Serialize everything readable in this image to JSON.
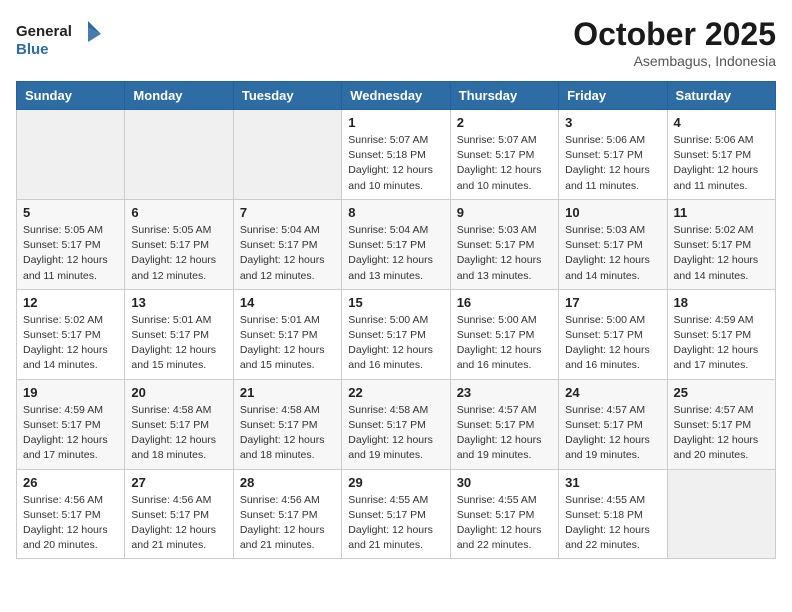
{
  "header": {
    "logo_line1": "General",
    "logo_line2": "Blue",
    "month": "October 2025",
    "location": "Asembagus, Indonesia"
  },
  "weekdays": [
    "Sunday",
    "Monday",
    "Tuesday",
    "Wednesday",
    "Thursday",
    "Friday",
    "Saturday"
  ],
  "weeks": [
    [
      {
        "day": "",
        "info": ""
      },
      {
        "day": "",
        "info": ""
      },
      {
        "day": "",
        "info": ""
      },
      {
        "day": "1",
        "info": "Sunrise: 5:07 AM\nSunset: 5:18 PM\nDaylight: 12 hours\nand 10 minutes."
      },
      {
        "day": "2",
        "info": "Sunrise: 5:07 AM\nSunset: 5:17 PM\nDaylight: 12 hours\nand 10 minutes."
      },
      {
        "day": "3",
        "info": "Sunrise: 5:06 AM\nSunset: 5:17 PM\nDaylight: 12 hours\nand 11 minutes."
      },
      {
        "day": "4",
        "info": "Sunrise: 5:06 AM\nSunset: 5:17 PM\nDaylight: 12 hours\nand 11 minutes."
      }
    ],
    [
      {
        "day": "5",
        "info": "Sunrise: 5:05 AM\nSunset: 5:17 PM\nDaylight: 12 hours\nand 11 minutes."
      },
      {
        "day": "6",
        "info": "Sunrise: 5:05 AM\nSunset: 5:17 PM\nDaylight: 12 hours\nand 12 minutes."
      },
      {
        "day": "7",
        "info": "Sunrise: 5:04 AM\nSunset: 5:17 PM\nDaylight: 12 hours\nand 12 minutes."
      },
      {
        "day": "8",
        "info": "Sunrise: 5:04 AM\nSunset: 5:17 PM\nDaylight: 12 hours\nand 13 minutes."
      },
      {
        "day": "9",
        "info": "Sunrise: 5:03 AM\nSunset: 5:17 PM\nDaylight: 12 hours\nand 13 minutes."
      },
      {
        "day": "10",
        "info": "Sunrise: 5:03 AM\nSunset: 5:17 PM\nDaylight: 12 hours\nand 14 minutes."
      },
      {
        "day": "11",
        "info": "Sunrise: 5:02 AM\nSunset: 5:17 PM\nDaylight: 12 hours\nand 14 minutes."
      }
    ],
    [
      {
        "day": "12",
        "info": "Sunrise: 5:02 AM\nSunset: 5:17 PM\nDaylight: 12 hours\nand 14 minutes."
      },
      {
        "day": "13",
        "info": "Sunrise: 5:01 AM\nSunset: 5:17 PM\nDaylight: 12 hours\nand 15 minutes."
      },
      {
        "day": "14",
        "info": "Sunrise: 5:01 AM\nSunset: 5:17 PM\nDaylight: 12 hours\nand 15 minutes."
      },
      {
        "day": "15",
        "info": "Sunrise: 5:00 AM\nSunset: 5:17 PM\nDaylight: 12 hours\nand 16 minutes."
      },
      {
        "day": "16",
        "info": "Sunrise: 5:00 AM\nSunset: 5:17 PM\nDaylight: 12 hours\nand 16 minutes."
      },
      {
        "day": "17",
        "info": "Sunrise: 5:00 AM\nSunset: 5:17 PM\nDaylight: 12 hours\nand 16 minutes."
      },
      {
        "day": "18",
        "info": "Sunrise: 4:59 AM\nSunset: 5:17 PM\nDaylight: 12 hours\nand 17 minutes."
      }
    ],
    [
      {
        "day": "19",
        "info": "Sunrise: 4:59 AM\nSunset: 5:17 PM\nDaylight: 12 hours\nand 17 minutes."
      },
      {
        "day": "20",
        "info": "Sunrise: 4:58 AM\nSunset: 5:17 PM\nDaylight: 12 hours\nand 18 minutes."
      },
      {
        "day": "21",
        "info": "Sunrise: 4:58 AM\nSunset: 5:17 PM\nDaylight: 12 hours\nand 18 minutes."
      },
      {
        "day": "22",
        "info": "Sunrise: 4:58 AM\nSunset: 5:17 PM\nDaylight: 12 hours\nand 19 minutes."
      },
      {
        "day": "23",
        "info": "Sunrise: 4:57 AM\nSunset: 5:17 PM\nDaylight: 12 hours\nand 19 minutes."
      },
      {
        "day": "24",
        "info": "Sunrise: 4:57 AM\nSunset: 5:17 PM\nDaylight: 12 hours\nand 19 minutes."
      },
      {
        "day": "25",
        "info": "Sunrise: 4:57 AM\nSunset: 5:17 PM\nDaylight: 12 hours\nand 20 minutes."
      }
    ],
    [
      {
        "day": "26",
        "info": "Sunrise: 4:56 AM\nSunset: 5:17 PM\nDaylight: 12 hours\nand 20 minutes."
      },
      {
        "day": "27",
        "info": "Sunrise: 4:56 AM\nSunset: 5:17 PM\nDaylight: 12 hours\nand 21 minutes."
      },
      {
        "day": "28",
        "info": "Sunrise: 4:56 AM\nSunset: 5:17 PM\nDaylight: 12 hours\nand 21 minutes."
      },
      {
        "day": "29",
        "info": "Sunrise: 4:55 AM\nSunset: 5:17 PM\nDaylight: 12 hours\nand 21 minutes."
      },
      {
        "day": "30",
        "info": "Sunrise: 4:55 AM\nSunset: 5:17 PM\nDaylight: 12 hours\nand 22 minutes."
      },
      {
        "day": "31",
        "info": "Sunrise: 4:55 AM\nSunset: 5:18 PM\nDaylight: 12 hours\nand 22 minutes."
      },
      {
        "day": "",
        "info": ""
      }
    ]
  ]
}
